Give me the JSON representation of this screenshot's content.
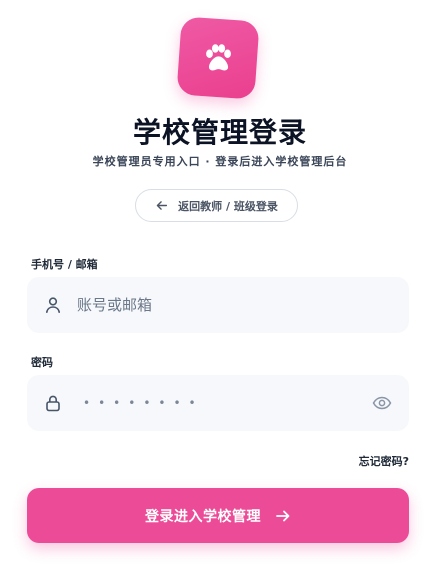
{
  "header": {
    "logo_icon": "paw-icon",
    "title": "学校管理登录",
    "subtitle": "学校管理员专用入口 · 登录后进入学校管理后台"
  },
  "back_button": {
    "icon": "arrow-left-icon",
    "label": "返回教师 / 班级登录"
  },
  "account_field": {
    "label": "手机号 / 邮箱",
    "icon": "user-icon",
    "placeholder": "账号或邮箱",
    "value": ""
  },
  "password_field": {
    "label": "密码",
    "icon": "lock-icon",
    "masked_value": "••••••••",
    "toggle_icon": "eye-icon"
  },
  "forgot_link": "忘记密码?",
  "submit_button": {
    "label": "登录进入学校管理",
    "icon": "arrow-right-icon"
  },
  "colors": {
    "accent": "#ec4b98",
    "title": "#0b1324",
    "field_bg": "#f6f8fb"
  }
}
